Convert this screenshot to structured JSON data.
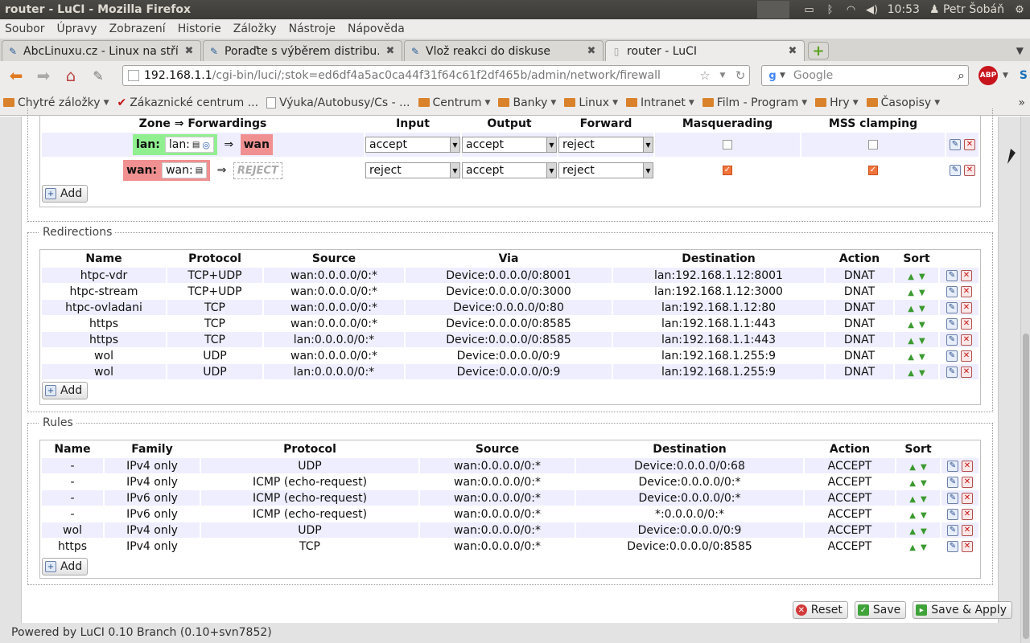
{
  "window": {
    "title": "router - LuCI - Mozilla Firefox"
  },
  "tray": {
    "clock": "10:53",
    "user": "Petr Šobáň"
  },
  "menubar": [
    "Soubor",
    "Úpravy",
    "Zobrazení",
    "Historie",
    "Záložky",
    "Nástroje",
    "Nápověda"
  ],
  "tabs": [
    {
      "label": "AbcLinuxu.cz - Linux na stří..."
    },
    {
      "label": "Poraďte s výběrem distribu..."
    },
    {
      "label": "Vlož reakci do diskuse"
    },
    {
      "label": "router - LuCI"
    }
  ],
  "nav": {
    "url_host": "192.168.1.1",
    "url_path": "/cgi-bin/luci/;stok=ed6df4a5ac0ca44f31f64c61f2df465b/admin/network/firewall",
    "search_placeholder": "Google",
    "abp": "ABP"
  },
  "bookmarks": [
    "Chytré záložky",
    "Zákaznické centrum ...",
    "Výuka/Autobusy/Cs - ...",
    "Centrum",
    "Banky",
    "Linux",
    "Intranet",
    "Film - Program",
    "Hry",
    "Časopisy"
  ],
  "zones": {
    "headers": [
      "Zone ⇒ Forwardings",
      "Input",
      "Output",
      "Forward",
      "Masquerading",
      "MSS clamping"
    ],
    "arrow": "⇒",
    "rows": [
      {
        "zone": "lan:",
        "net": "lan:",
        "target": "wan",
        "input": "accept",
        "output": "accept",
        "forward": "reject",
        "masq": false,
        "mss": false,
        "zone_color": "#90f090",
        "target_color": "#f09090"
      },
      {
        "zone": "wan:",
        "net": "wan:",
        "target": "REJECT",
        "input": "reject",
        "output": "accept",
        "forward": "reject",
        "masq": true,
        "mss": true,
        "zone_color": "#f09090"
      }
    ],
    "add": "Add"
  },
  "redirections": {
    "legend": "Redirections",
    "headers": [
      "Name",
      "Protocol",
      "Source",
      "Via",
      "Destination",
      "Action",
      "Sort"
    ],
    "rows": [
      [
        "htpc-vdr",
        "TCP+UDP",
        "wan:0.0.0.0/0:*",
        "Device:0.0.0.0/0:8001",
        "lan:192.168.1.12:8001",
        "DNAT"
      ],
      [
        "htpc-stream",
        "TCP+UDP",
        "wan:0.0.0.0/0:*",
        "Device:0.0.0.0/0:3000",
        "lan:192.168.1.12:3000",
        "DNAT"
      ],
      [
        "htpc-ovladani",
        "TCP",
        "wan:0.0.0.0/0:*",
        "Device:0.0.0.0/0:80",
        "lan:192.168.1.12:80",
        "DNAT"
      ],
      [
        "https",
        "TCP",
        "wan:0.0.0.0/0:*",
        "Device:0.0.0.0/0:8585",
        "lan:192.168.1.1:443",
        "DNAT"
      ],
      [
        "https",
        "TCP",
        "lan:0.0.0.0/0:*",
        "Device:0.0.0.0/0:8585",
        "lan:192.168.1.1:443",
        "DNAT"
      ],
      [
        "wol",
        "UDP",
        "wan:0.0.0.0/0:*",
        "Device:0.0.0.0/0:9",
        "lan:192.168.1.255:9",
        "DNAT"
      ],
      [
        "wol",
        "UDP",
        "lan:0.0.0.0/0:*",
        "Device:0.0.0.0/0:9",
        "lan:192.168.1.255:9",
        "DNAT"
      ]
    ],
    "add": "Add"
  },
  "rules": {
    "legend": "Rules",
    "headers": [
      "Name",
      "Family",
      "Protocol",
      "Source",
      "Destination",
      "Action",
      "Sort"
    ],
    "rows": [
      [
        "-",
        "IPv4 only",
        "UDP",
        "wan:0.0.0.0/0:*",
        "Device:0.0.0.0/0:68",
        "ACCEPT"
      ],
      [
        "-",
        "IPv4 only",
        "ICMP (echo-request)",
        "wan:0.0.0.0/0:*",
        "Device:0.0.0.0/0:*",
        "ACCEPT"
      ],
      [
        "-",
        "IPv6 only",
        "ICMP (echo-request)",
        "wan:0.0.0.0/0:*",
        "Device:0.0.0.0/0:*",
        "ACCEPT"
      ],
      [
        "-",
        "IPv6 only",
        "ICMP (echo-request)",
        "wan:0.0.0.0/0:*",
        "*:0.0.0.0/0:*",
        "ACCEPT"
      ],
      [
        "wol",
        "IPv4 only",
        "UDP",
        "wan:0.0.0.0/0:*",
        "Device:0.0.0.0/0:9",
        "ACCEPT"
      ],
      [
        "https",
        "IPv4 only",
        "TCP",
        "wan:0.0.0.0/0:*",
        "Device:0.0.0.0/0:8585",
        "ACCEPT"
      ]
    ],
    "add": "Add"
  },
  "actions": {
    "reset": "Reset",
    "save": "Save",
    "save_apply": "Save & Apply"
  },
  "footer": "Powered by LuCI 0.10 Branch (0.10+svn7852)"
}
